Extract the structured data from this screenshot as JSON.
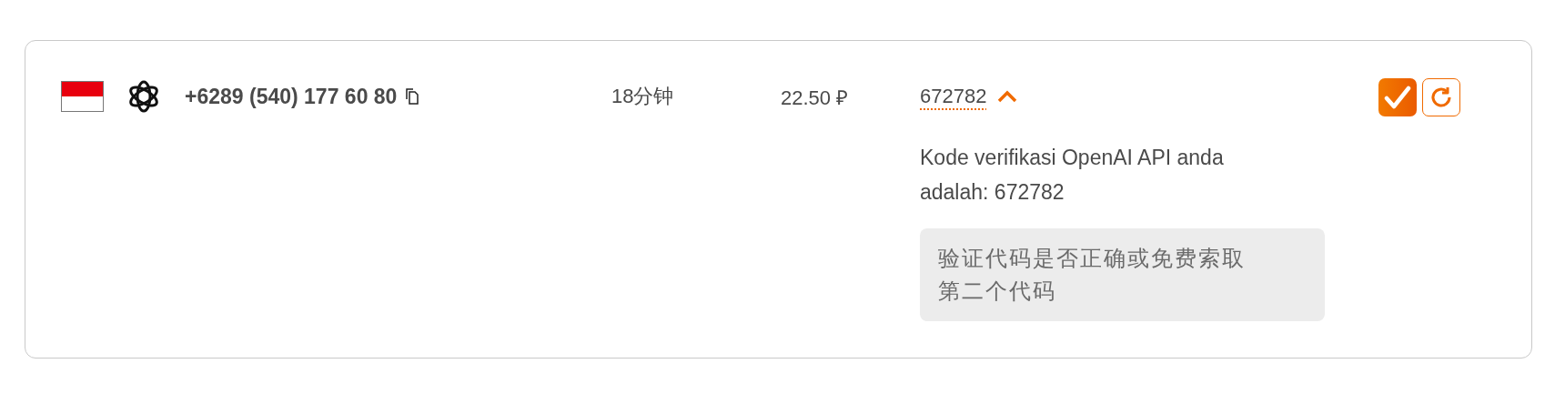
{
  "activation": {
    "phone": "+6289 (540) 177 60 80",
    "duration": "18分钟",
    "price": "22.50 ₽",
    "code": "672782",
    "expanded": true,
    "message": "Kode verifikasi OpenAI API anda adalah: 672782",
    "hint": "验证代码是否正确或免费索取第二个代码"
  }
}
